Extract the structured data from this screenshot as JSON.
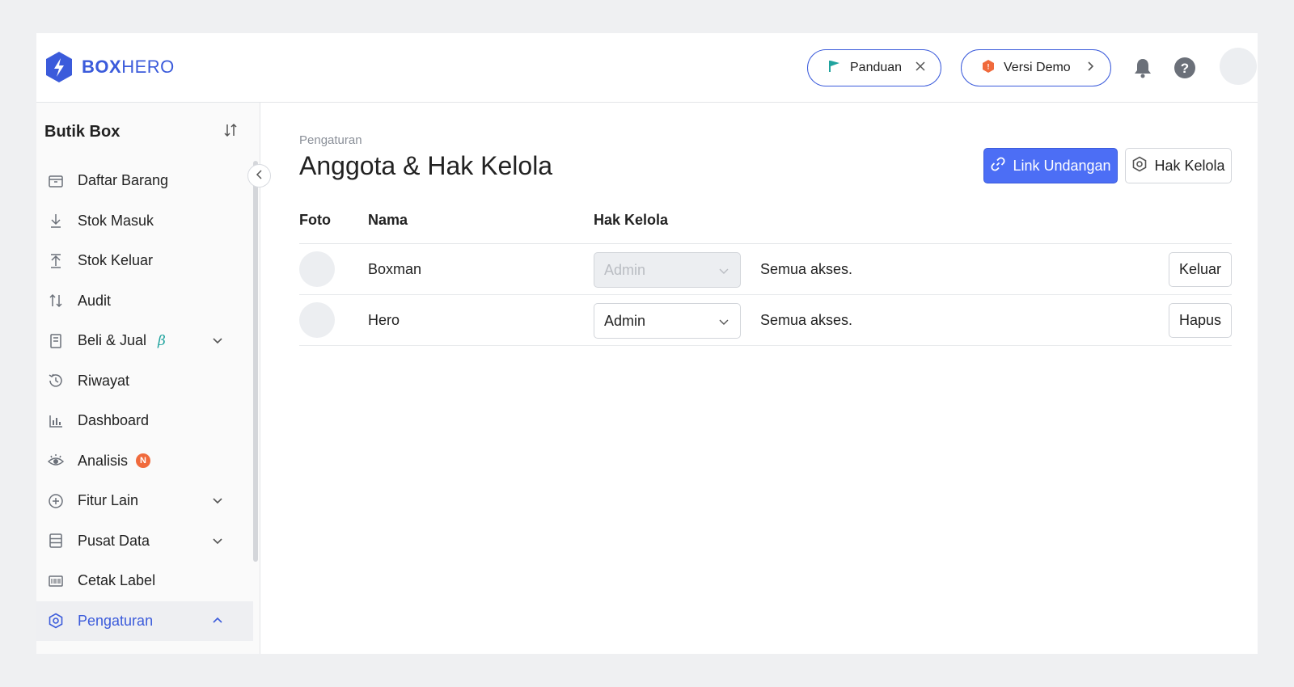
{
  "brand": {
    "name_bold": "BOX",
    "name_light": "HERO",
    "color": "#3b5bdb"
  },
  "topbar": {
    "guide_label": "Panduan",
    "demo_label": "Versi Demo",
    "icons": [
      "flag-icon",
      "close-icon",
      "alert-badge-icon",
      "chevron-right-icon",
      "bell-icon",
      "help-icon"
    ]
  },
  "sidebar": {
    "store_name": "Butik Box",
    "items": [
      {
        "label": "Daftar Barang",
        "icon": "box-icon"
      },
      {
        "label": "Stok Masuk",
        "icon": "arrow-down-icon"
      },
      {
        "label": "Stok Keluar",
        "icon": "arrow-up-icon"
      },
      {
        "label": "Audit",
        "icon": "swap-icon"
      },
      {
        "label": "Beli & Jual",
        "icon": "receipt-icon",
        "beta": "β",
        "expandable": true
      },
      {
        "label": "Riwayat",
        "icon": "history-icon"
      },
      {
        "label": "Dashboard",
        "icon": "bar-chart-icon"
      },
      {
        "label": "Analisis",
        "icon": "eye-icon",
        "badge": "N"
      },
      {
        "label": "Fitur Lain",
        "icon": "plus-circle-icon",
        "expandable": true
      },
      {
        "label": "Pusat Data",
        "icon": "database-icon",
        "expandable": true
      },
      {
        "label": "Cetak Label",
        "icon": "barcode-icon"
      },
      {
        "label": "Pengaturan",
        "icon": "gear-icon",
        "expandable": true,
        "active": true
      }
    ]
  },
  "main": {
    "breadcrumb": "Pengaturan",
    "title": "Anggota & Hak Kelola",
    "invite_button": "Link Undangan",
    "permission_button": "Hak Kelola",
    "table": {
      "headers": {
        "photo": "Foto",
        "name": "Nama",
        "role": "Hak Kelola"
      },
      "rows": [
        {
          "name": "Boxman",
          "role": "Admin",
          "role_disabled": true,
          "description": "Semua akses.",
          "action": "Keluar"
        },
        {
          "name": "Hero",
          "role": "Admin",
          "role_disabled": false,
          "description": "Semua akses.",
          "action": "Hapus"
        }
      ]
    }
  },
  "colors": {
    "accent": "#4c6ef5",
    "accent_dark": "#3b5bdb",
    "teal": "#20a39e",
    "badge": "#f06a3c",
    "muted": "#8a8f98"
  }
}
